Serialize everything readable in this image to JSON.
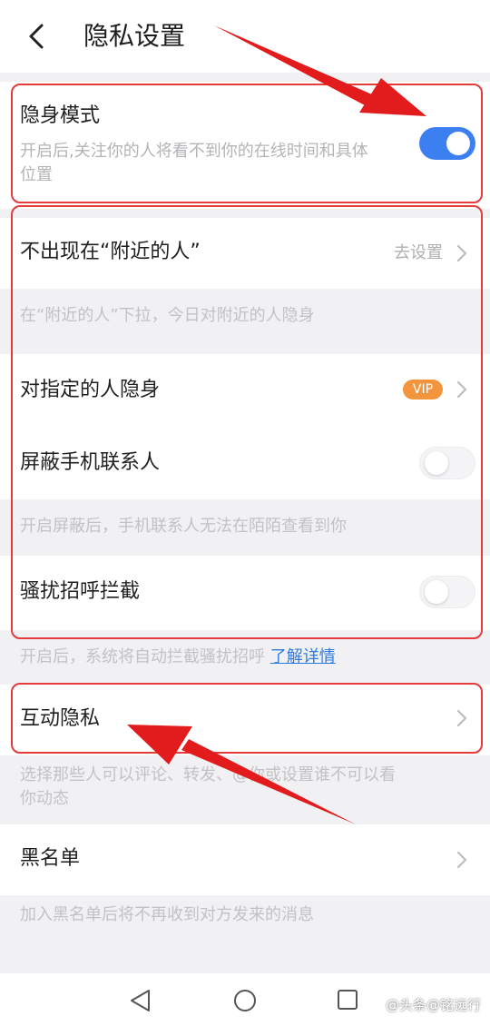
{
  "header": {
    "title": "隐私设置"
  },
  "stealth": {
    "title": "隐身模式",
    "desc_line1": "开启后,关注你的人将看不到你的在线时间和具体",
    "desc_line2": "位置",
    "enabled": true
  },
  "nearby": {
    "title": "不出现在“附近的人”",
    "action": "去设置",
    "hint": "在“附近的人”下拉，今日对附近的人隐身"
  },
  "specific": {
    "title": "对指定的人隐身",
    "badge": "VIP"
  },
  "contacts": {
    "title": "屏蔽手机联系人",
    "enabled": false,
    "hint": "开启屏蔽后，手机联系人无法在陌陌查看到你"
  },
  "harass": {
    "title": "骚扰招呼拦截",
    "enabled": false,
    "hint": "开启后，系统将自动拦截骚扰招呼",
    "link": "了解详情"
  },
  "interaction": {
    "title": "互动隐私",
    "hint_line1": "选择那些人可以评论、转发、@你或设置谁不可以看",
    "hint_line2": "你动态"
  },
  "blacklist": {
    "title": "黑名单",
    "hint": "加入黑名单后将不再收到对方发来的消息"
  },
  "watermark": "@头条@铭远行",
  "colors": {
    "accent": "#3c7ff0",
    "vip": "#f3953c",
    "annotation": "#e43b3b"
  }
}
